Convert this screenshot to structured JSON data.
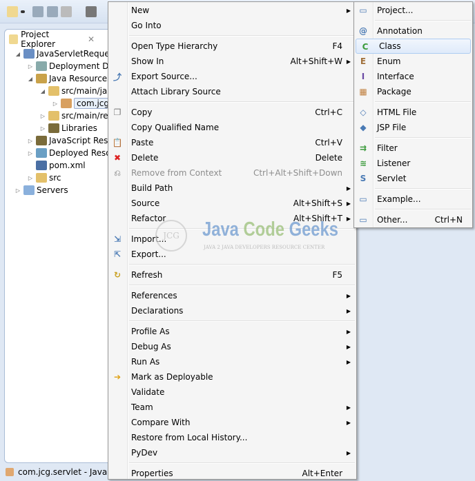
{
  "toolbar": {
    "icons": [
      "new-wizard-icon",
      "dropdown-icon",
      "save-icon",
      "save-all-icon",
      "print-icon",
      "binary-icon"
    ]
  },
  "explorer": {
    "tab_label": "Project Explorer",
    "tree": [
      {
        "label": "JavaServletRequest",
        "depth": 0,
        "tw": "◢",
        "icon": "web-project-icon",
        "color": "#6a8fc4"
      },
      {
        "label": "Deployment De",
        "depth": 1,
        "tw": "▷",
        "icon": "deployment-descriptor-icon",
        "color": "#8aa"
      },
      {
        "label": "Java Resources",
        "depth": 1,
        "tw": "◢",
        "icon": "java-resources-icon",
        "color": "#c9a24a"
      },
      {
        "label": "src/main/ja",
        "depth": 2,
        "tw": "◢",
        "icon": "source-folder-icon",
        "color": "#e3c06a"
      },
      {
        "label": "com.jcg",
        "depth": 3,
        "tw": "▷",
        "icon": "package-icon",
        "color": "#d8a060",
        "selected": true
      },
      {
        "label": "src/main/re",
        "depth": 2,
        "tw": "▷",
        "icon": "source-folder-icon",
        "color": "#e3c06a"
      },
      {
        "label": "Libraries",
        "depth": 2,
        "tw": "▷",
        "icon": "libraries-icon",
        "color": "#7a6b3a"
      },
      {
        "label": "JavaScript Reso",
        "depth": 1,
        "tw": "▷",
        "icon": "javascript-resources-icon",
        "color": "#7a6b3a"
      },
      {
        "label": "Deployed Resou",
        "depth": 1,
        "tw": "▷",
        "icon": "deployed-resources-icon",
        "color": "#6a9fc4"
      },
      {
        "label": "pom.xml",
        "depth": 1,
        "tw": "",
        "icon": "maven-file-icon",
        "color": "#4a6fa4"
      },
      {
        "label": "src",
        "depth": 1,
        "tw": "▷",
        "icon": "folder-icon",
        "color": "#e3c06a"
      },
      {
        "label": "Servers",
        "depth": 0,
        "tw": "▷",
        "icon": "folder-icon",
        "color": "#8ab0dc"
      }
    ]
  },
  "status": {
    "text": "com.jcg.servlet - JavaSer"
  },
  "context_menu": [
    {
      "label": "New",
      "submenu": true
    },
    {
      "label": "Go Into"
    },
    {
      "sep": true
    },
    {
      "label": "Open Type Hierarchy",
      "shortcut": "F4"
    },
    {
      "label": "Show In",
      "shortcut": "Alt+Shift+W",
      "submenu": true
    },
    {
      "label": "Export Source...",
      "icon": "export-source-icon",
      "glyph": "⤴",
      "color": "#4a7ab4"
    },
    {
      "label": "Attach Library Source"
    },
    {
      "sep": true
    },
    {
      "label": "Copy",
      "shortcut": "Ctrl+C",
      "icon": "copy-icon",
      "glyph": "❐",
      "color": "#777"
    },
    {
      "label": "Copy Qualified Name"
    },
    {
      "label": "Paste",
      "shortcut": "Ctrl+V",
      "icon": "paste-icon",
      "glyph": "📋",
      "color": "#a88"
    },
    {
      "label": "Delete",
      "shortcut": "Delete",
      "icon": "delete-icon",
      "glyph": "✖",
      "color": "#d22"
    },
    {
      "label": "Remove from Context",
      "shortcut": "Ctrl+Alt+Shift+Down",
      "disabled": true,
      "icon": "remove-context-icon",
      "glyph": "⎌",
      "color": "#aaa"
    },
    {
      "label": "Build Path",
      "submenu": true
    },
    {
      "label": "Source",
      "shortcut": "Alt+Shift+S",
      "submenu": true
    },
    {
      "label": "Refactor",
      "shortcut": "Alt+Shift+T",
      "submenu": true
    },
    {
      "sep": true
    },
    {
      "label": "Import...",
      "icon": "import-icon",
      "glyph": "⇲",
      "color": "#4a7ab4"
    },
    {
      "label": "Export...",
      "icon": "export-icon",
      "glyph": "⇱",
      "color": "#4a7ab4"
    },
    {
      "sep": true
    },
    {
      "label": "Refresh",
      "shortcut": "F5",
      "icon": "refresh-icon",
      "glyph": "↻",
      "color": "#c9a020"
    },
    {
      "sep": true
    },
    {
      "label": "References",
      "submenu": true
    },
    {
      "label": "Declarations",
      "submenu": true
    },
    {
      "sep": true
    },
    {
      "label": "Profile As",
      "submenu": true
    },
    {
      "label": "Debug As",
      "submenu": true
    },
    {
      "label": "Run As",
      "submenu": true
    },
    {
      "label": "Mark as Deployable",
      "icon": "deployable-icon",
      "glyph": "➔",
      "color": "#e0a010"
    },
    {
      "label": "Validate"
    },
    {
      "label": "Team",
      "submenu": true
    },
    {
      "label": "Compare With",
      "submenu": true
    },
    {
      "label": "Restore from Local History..."
    },
    {
      "label": "PyDev",
      "submenu": true
    },
    {
      "sep": true
    },
    {
      "label": "Properties",
      "shortcut": "Alt+Enter"
    }
  ],
  "new_submenu": [
    {
      "label": "Project...",
      "icon": "new-project-icon",
      "glyph": "▭",
      "color": "#4a7ab4"
    },
    {
      "sep": true
    },
    {
      "label": "Annotation",
      "icon": "annotation-icon",
      "glyph": "@",
      "color": "#4a7ab4"
    },
    {
      "label": "Class",
      "icon": "class-icon",
      "glyph": "C",
      "color": "#3a9a3a",
      "highlighted": true
    },
    {
      "label": "Enum",
      "icon": "enum-icon",
      "glyph": "E",
      "color": "#a0703a"
    },
    {
      "label": "Interface",
      "icon": "interface-icon",
      "glyph": "I",
      "color": "#6a4aa4"
    },
    {
      "label": "Package",
      "icon": "package-icon",
      "glyph": "▦",
      "color": "#c08040"
    },
    {
      "sep": true
    },
    {
      "label": "HTML File",
      "icon": "html-file-icon",
      "glyph": "◇",
      "color": "#4a7ab4"
    },
    {
      "label": "JSP File",
      "icon": "jsp-file-icon",
      "glyph": "◆",
      "color": "#4a7ab4"
    },
    {
      "sep": true
    },
    {
      "label": "Filter",
      "icon": "filter-icon",
      "glyph": "⇉",
      "color": "#3a9a3a"
    },
    {
      "label": "Listener",
      "icon": "listener-icon",
      "glyph": "≋",
      "color": "#3a9a3a"
    },
    {
      "label": "Servlet",
      "icon": "servlet-icon",
      "glyph": "S",
      "color": "#4a7ab4"
    },
    {
      "sep": true
    },
    {
      "label": "Example...",
      "icon": "example-icon",
      "glyph": "▭",
      "color": "#4a7ab4"
    },
    {
      "sep": true
    },
    {
      "label": "Other...",
      "shortcut": "Ctrl+N",
      "icon": "other-wizard-icon",
      "glyph": "▭",
      "color": "#4a7ab4"
    }
  ],
  "watermark": {
    "brand": "Java Code Geeks",
    "tagline": "JAVA 2 JAVA DEVELOPERS RESOURCE CENTER",
    "logo_text": "JCG"
  },
  "colors": {
    "accent": "#aeccf1",
    "menu_bg": "#f5f5f5"
  }
}
